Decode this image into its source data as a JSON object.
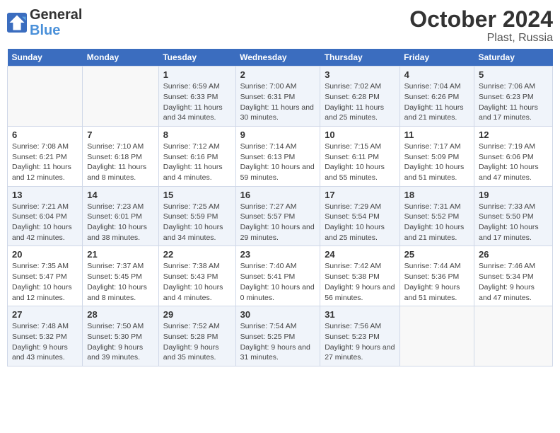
{
  "header": {
    "logo_line1": "General",
    "logo_line2": "Blue",
    "title": "October 2024",
    "subtitle": "Plast, Russia"
  },
  "weekdays": [
    "Sunday",
    "Monday",
    "Tuesday",
    "Wednesday",
    "Thursday",
    "Friday",
    "Saturday"
  ],
  "weeks": [
    [
      {
        "day": null
      },
      {
        "day": null
      },
      {
        "day": "1",
        "sunrise": "Sunrise: 6:59 AM",
        "sunset": "Sunset: 6:33 PM",
        "daylight": "Daylight: 11 hours and 34 minutes."
      },
      {
        "day": "2",
        "sunrise": "Sunrise: 7:00 AM",
        "sunset": "Sunset: 6:31 PM",
        "daylight": "Daylight: 11 hours and 30 minutes."
      },
      {
        "day": "3",
        "sunrise": "Sunrise: 7:02 AM",
        "sunset": "Sunset: 6:28 PM",
        "daylight": "Daylight: 11 hours and 25 minutes."
      },
      {
        "day": "4",
        "sunrise": "Sunrise: 7:04 AM",
        "sunset": "Sunset: 6:26 PM",
        "daylight": "Daylight: 11 hours and 21 minutes."
      },
      {
        "day": "5",
        "sunrise": "Sunrise: 7:06 AM",
        "sunset": "Sunset: 6:23 PM",
        "daylight": "Daylight: 11 hours and 17 minutes."
      }
    ],
    [
      {
        "day": "6",
        "sunrise": "Sunrise: 7:08 AM",
        "sunset": "Sunset: 6:21 PM",
        "daylight": "Daylight: 11 hours and 12 minutes."
      },
      {
        "day": "7",
        "sunrise": "Sunrise: 7:10 AM",
        "sunset": "Sunset: 6:18 PM",
        "daylight": "Daylight: 11 hours and 8 minutes."
      },
      {
        "day": "8",
        "sunrise": "Sunrise: 7:12 AM",
        "sunset": "Sunset: 6:16 PM",
        "daylight": "Daylight: 11 hours and 4 minutes."
      },
      {
        "day": "9",
        "sunrise": "Sunrise: 7:14 AM",
        "sunset": "Sunset: 6:13 PM",
        "daylight": "Daylight: 10 hours and 59 minutes."
      },
      {
        "day": "10",
        "sunrise": "Sunrise: 7:15 AM",
        "sunset": "Sunset: 6:11 PM",
        "daylight": "Daylight: 10 hours and 55 minutes."
      },
      {
        "day": "11",
        "sunrise": "Sunrise: 7:17 AM",
        "sunset": "Sunset: 5:09 PM",
        "daylight": "Daylight: 10 hours and 51 minutes."
      },
      {
        "day": "12",
        "sunrise": "Sunrise: 7:19 AM",
        "sunset": "Sunset: 6:06 PM",
        "daylight": "Daylight: 10 hours and 47 minutes."
      }
    ],
    [
      {
        "day": "13",
        "sunrise": "Sunrise: 7:21 AM",
        "sunset": "Sunset: 6:04 PM",
        "daylight": "Daylight: 10 hours and 42 minutes."
      },
      {
        "day": "14",
        "sunrise": "Sunrise: 7:23 AM",
        "sunset": "Sunset: 6:01 PM",
        "daylight": "Daylight: 10 hours and 38 minutes."
      },
      {
        "day": "15",
        "sunrise": "Sunrise: 7:25 AM",
        "sunset": "Sunset: 5:59 PM",
        "daylight": "Daylight: 10 hours and 34 minutes."
      },
      {
        "day": "16",
        "sunrise": "Sunrise: 7:27 AM",
        "sunset": "Sunset: 5:57 PM",
        "daylight": "Daylight: 10 hours and 29 minutes."
      },
      {
        "day": "17",
        "sunrise": "Sunrise: 7:29 AM",
        "sunset": "Sunset: 5:54 PM",
        "daylight": "Daylight: 10 hours and 25 minutes."
      },
      {
        "day": "18",
        "sunrise": "Sunrise: 7:31 AM",
        "sunset": "Sunset: 5:52 PM",
        "daylight": "Daylight: 10 hours and 21 minutes."
      },
      {
        "day": "19",
        "sunrise": "Sunrise: 7:33 AM",
        "sunset": "Sunset: 5:50 PM",
        "daylight": "Daylight: 10 hours and 17 minutes."
      }
    ],
    [
      {
        "day": "20",
        "sunrise": "Sunrise: 7:35 AM",
        "sunset": "Sunset: 5:47 PM",
        "daylight": "Daylight: 10 hours and 12 minutes."
      },
      {
        "day": "21",
        "sunrise": "Sunrise: 7:37 AM",
        "sunset": "Sunset: 5:45 PM",
        "daylight": "Daylight: 10 hours and 8 minutes."
      },
      {
        "day": "22",
        "sunrise": "Sunrise: 7:38 AM",
        "sunset": "Sunset: 5:43 PM",
        "daylight": "Daylight: 10 hours and 4 minutes."
      },
      {
        "day": "23",
        "sunrise": "Sunrise: 7:40 AM",
        "sunset": "Sunset: 5:41 PM",
        "daylight": "Daylight: 10 hours and 0 minutes."
      },
      {
        "day": "24",
        "sunrise": "Sunrise: 7:42 AM",
        "sunset": "Sunset: 5:38 PM",
        "daylight": "Daylight: 9 hours and 56 minutes."
      },
      {
        "day": "25",
        "sunrise": "Sunrise: 7:44 AM",
        "sunset": "Sunset: 5:36 PM",
        "daylight": "Daylight: 9 hours and 51 minutes."
      },
      {
        "day": "26",
        "sunrise": "Sunrise: 7:46 AM",
        "sunset": "Sunset: 5:34 PM",
        "daylight": "Daylight: 9 hours and 47 minutes."
      }
    ],
    [
      {
        "day": "27",
        "sunrise": "Sunrise: 7:48 AM",
        "sunset": "Sunset: 5:32 PM",
        "daylight": "Daylight: 9 hours and 43 minutes."
      },
      {
        "day": "28",
        "sunrise": "Sunrise: 7:50 AM",
        "sunset": "Sunset: 5:30 PM",
        "daylight": "Daylight: 9 hours and 39 minutes."
      },
      {
        "day": "29",
        "sunrise": "Sunrise: 7:52 AM",
        "sunset": "Sunset: 5:28 PM",
        "daylight": "Daylight: 9 hours and 35 minutes."
      },
      {
        "day": "30",
        "sunrise": "Sunrise: 7:54 AM",
        "sunset": "Sunset: 5:25 PM",
        "daylight": "Daylight: 9 hours and 31 minutes."
      },
      {
        "day": "31",
        "sunrise": "Sunrise: 7:56 AM",
        "sunset": "Sunset: 5:23 PM",
        "daylight": "Daylight: 9 hours and 27 minutes."
      },
      {
        "day": null
      },
      {
        "day": null
      }
    ]
  ]
}
